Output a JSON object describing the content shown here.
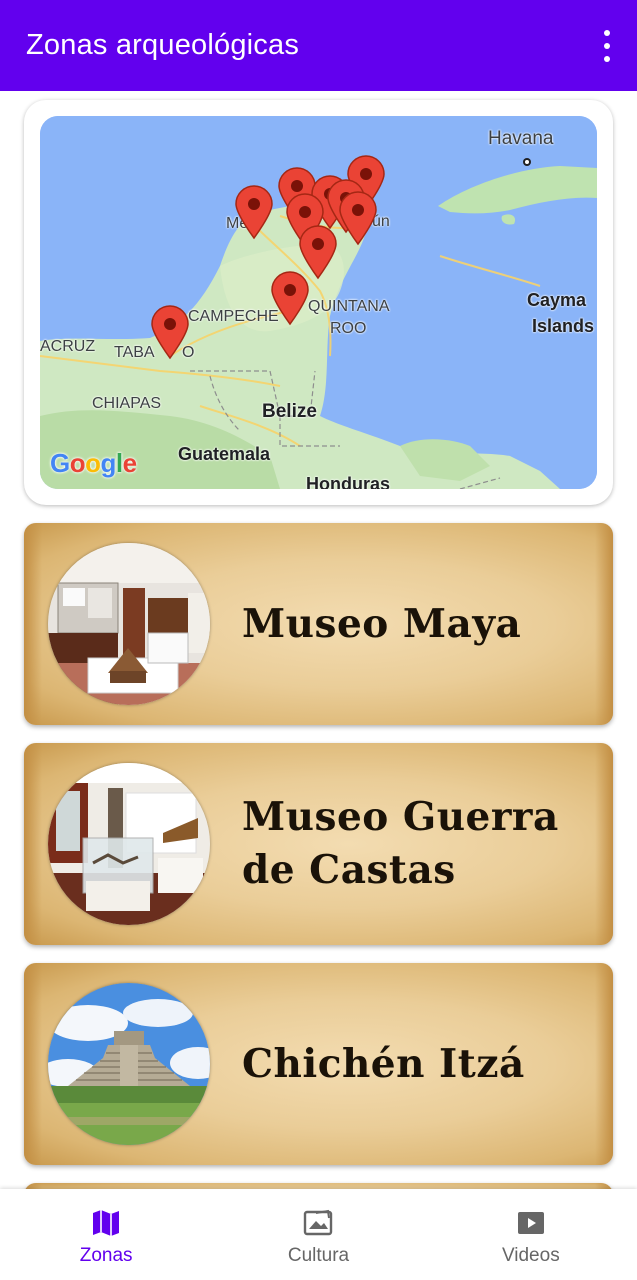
{
  "app_bar": {
    "title": "Zonas arqueológicas",
    "menu_icon": "more-vert-icon"
  },
  "map": {
    "labels": {
      "havana": "Havana",
      "merida": "Mé",
      "cancun": "ún",
      "campeche": "CAMPECHE",
      "quintana_roo_1": "QUINTANA",
      "quintana_roo_2": "ROO",
      "cayman_1": "Cayma",
      "cayman_2": "Islands",
      "veracruz": "ACRUZ",
      "tabasco": "TABA",
      "tabasco_end": "O",
      "chiapas": "CHIAPAS",
      "belize": "Belize",
      "guatemala": "Guatemala",
      "honduras": "Honduras"
    },
    "attribution": {
      "g1": "G",
      "o1": "o",
      "o2": "o",
      "g2": "g",
      "l": "l",
      "e": "e"
    },
    "marker_icon": "map-pin-icon"
  },
  "places": [
    {
      "name": "Museo Maya",
      "image_icon": "museum-interior-photo"
    },
    {
      "name": "Museo Guerra de Castas",
      "image_icon": "museum-exhibit-photo"
    },
    {
      "name": "Chichén Itzá",
      "image_icon": "pyramid-photo"
    }
  ],
  "bottom_nav": {
    "items": [
      {
        "label": "Zonas",
        "icon": "map-icon",
        "active": true
      },
      {
        "label": "Cultura",
        "icon": "culture-icon",
        "active": false
      },
      {
        "label": "Videos",
        "icon": "video-icon",
        "active": false
      }
    ]
  },
  "colors": {
    "primary": "#6200EE",
    "inactive": "#666666",
    "parchment": "#eacd98",
    "marker": "#ea4335"
  }
}
